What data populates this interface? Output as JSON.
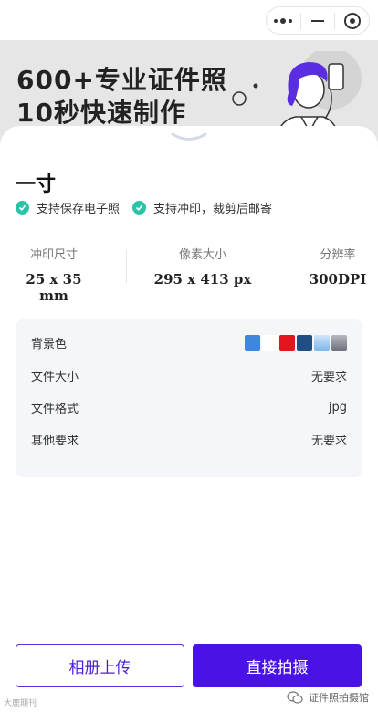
{
  "banner": {
    "title_line1": "600+专业证件照",
    "title_line2": "10秒快速制作"
  },
  "capsule": {
    "more_icon": "more-dots-icon",
    "minimize_icon": "minus-icon",
    "close_icon": "target-icon"
  },
  "size": {
    "name": "一寸",
    "features": [
      "支持保存电子照",
      "支持冲印，裁剪后邮寄"
    ]
  },
  "specs": {
    "print_label": "冲印尺寸",
    "print_value": "25 x 35 mm",
    "pixel_label": "像素大小",
    "pixel_value": "295 x 413 px",
    "dpi_label": "分辨率",
    "dpi_value": "300DPI"
  },
  "info": {
    "bg_label": "背景色",
    "bg_colors": [
      "#3f86e0",
      "#ffffff",
      "#e8141c",
      "#1f4e85",
      "#9fcdf2",
      "#8a8c98"
    ],
    "filesize_label": "文件大小",
    "filesize_value": "无要求",
    "format_label": "文件格式",
    "format_value": "jpg",
    "other_label": "其他要求",
    "other_value": "无要求"
  },
  "buttons": {
    "album": "相册上传",
    "shoot": "直接拍摄"
  },
  "watermark": {
    "left": "大鹿期刊",
    "right": "证件照拍摄馆"
  },
  "colors": {
    "accent": "#4a12e6",
    "check": "#2bc3a8",
    "panel": "#f5f6f9"
  }
}
